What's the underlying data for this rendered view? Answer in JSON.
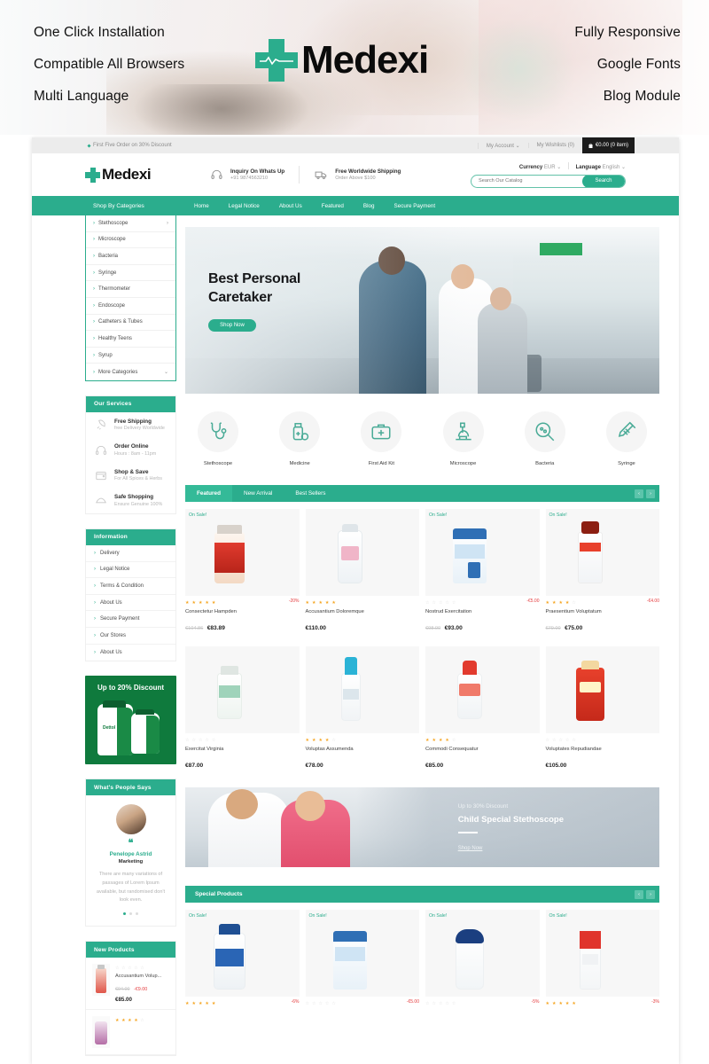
{
  "promo": {
    "left_features": [
      "One Click Installation",
      "Compatible All Browsers",
      "Multi Language"
    ],
    "right_features": [
      "Fully Responsive",
      "Google Fonts",
      "Blog Module"
    ],
    "logo_text": "Medexi"
  },
  "topbar": {
    "deal_text": "First Five Order on 30% Discount",
    "my_account": "My Account",
    "wishlists": "My Wishlists (0)",
    "cart": "€0.00 (0 item)"
  },
  "header": {
    "brand": "Medexi",
    "info": [
      {
        "title": "Inquiry On Whats Up",
        "sub": "+91 9874563210",
        "icon": "headset-icon"
      },
      {
        "title": "Free Worldwide Shipping",
        "sub": "Order Above $100",
        "icon": "truck-icon"
      }
    ],
    "currency_label": "Currency",
    "currency_value": "EUR",
    "language_label": "Language",
    "language_value": "English",
    "search_placeholder": "Search Our Catalog",
    "search_button": "Search"
  },
  "nav": {
    "categories_title": "Shop By Categories",
    "items": [
      "Home",
      "Legal Notice",
      "About Us",
      "Featured",
      "Blog",
      "Secure Payment"
    ]
  },
  "categories": [
    {
      "label": "Stethoscope",
      "arrow": "›"
    },
    {
      "label": "Microscope",
      "arrow": ""
    },
    {
      "label": "Bacteria",
      "arrow": ""
    },
    {
      "label": "Syringe",
      "arrow": ""
    },
    {
      "label": "Thermometer",
      "arrow": ""
    },
    {
      "label": "Endoscope",
      "arrow": ""
    },
    {
      "label": "Catheters & Tubes",
      "arrow": ""
    },
    {
      "label": "Healthy Teens",
      "arrow": ""
    },
    {
      "label": "Syrup",
      "arrow": ""
    },
    {
      "label": "More Categories",
      "arrow": "⌄"
    }
  ],
  "services": {
    "title": "Our Services",
    "items": [
      {
        "title": "Free Shipping",
        "sub": "free Delivery Worldwide",
        "icon": "rocket-icon"
      },
      {
        "title": "Order Online",
        "sub": "Hours : 8am - 11pm",
        "icon": "headset-icon"
      },
      {
        "title": "Shop & Save",
        "sub": "For All Spices & Herbs",
        "icon": "wallet-icon"
      },
      {
        "title": "Safe Shopping",
        "sub": "Ensure Genuine 100%",
        "icon": "shield-icon"
      }
    ]
  },
  "information": {
    "title": "Information",
    "items": [
      "Delivery",
      "Legal Notice",
      "Terms & Condition",
      "About Us",
      "Secure Payment",
      "Our Stores",
      "About Us"
    ]
  },
  "side_banner": {
    "title": "Up to 20% Discount",
    "product_label": "Dettol"
  },
  "testimonial": {
    "title": "What's People Says",
    "quote_mark": "❝",
    "name": "Penelope Astrid",
    "role": "Marketing",
    "text": "There are many variations of passages of Lorem Ipsum available, but randomised don't look even."
  },
  "new_products": {
    "title": "New Products",
    "items": [
      {
        "name": "Accusantium Volup...",
        "old": "€94.00",
        "cut": "-€9.00",
        "new": "€85.00",
        "rating": 0
      },
      {
        "name": "",
        "old": "",
        "cut": "",
        "new": "",
        "rating": 4
      }
    ]
  },
  "hero": {
    "title_line1": "Best Personal",
    "title_line2": "Caretaker",
    "button": "Shop Now"
  },
  "icon_categories": [
    {
      "name": "Stethoscope",
      "icon": "stethoscope-icon"
    },
    {
      "name": "Medicine",
      "icon": "medicine-bottle-icon"
    },
    {
      "name": "First Aid Kit",
      "icon": "first-aid-kit-icon"
    },
    {
      "name": "Microscope",
      "icon": "microscope-icon"
    },
    {
      "name": "Bacteria",
      "icon": "bacteria-magnifier-icon"
    },
    {
      "name": "Syringe",
      "icon": "syringe-icon"
    }
  ],
  "featured": {
    "tabs": [
      "Featured",
      "New Arrival",
      "Best Sellers"
    ],
    "active_tab": "Featured",
    "prev": "‹",
    "next": "›",
    "row1": [
      {
        "name": "Consectetur Hampden",
        "old": "€104.86",
        "new": "€83.89",
        "discount": "-20%",
        "on_sale": "On Sale!",
        "rating": 5,
        "product": "arthro-box"
      },
      {
        "name": "Accusantium Doloremque",
        "old": "",
        "new": "€110.00",
        "discount": "",
        "on_sale": "",
        "rating": 5,
        "product": "johnsons-powder"
      },
      {
        "name": "Nostrud Exercitation",
        "old": "€98.00",
        "new": "€93.00",
        "discount": "-€5.00",
        "on_sale": "On Sale!",
        "rating": 0,
        "product": "aptamil-tin"
      },
      {
        "name": "Praesentium Voluptatum",
        "old": "€79.00",
        "new": "€75.00",
        "discount": "-€4.00",
        "on_sale": "On Sale!",
        "rating": 4,
        "product": "diprobase-tube"
      }
    ],
    "row2": [
      {
        "name": "Exercitat Virginia",
        "old": "",
        "new": "€87.00",
        "discount": "",
        "on_sale": "",
        "rating": 0,
        "product": "nervocare-bottle"
      },
      {
        "name": "Voluptas Assumenda",
        "old": "",
        "new": "€78.00",
        "discount": "",
        "on_sale": "",
        "rating": 4,
        "product": "anne-french-bottle"
      },
      {
        "name": "Commodi Consequatur",
        "old": "",
        "new": "€85.00",
        "discount": "",
        "on_sale": "",
        "rating": 4,
        "product": "comfort-bottle"
      },
      {
        "name": "Voluptates Repudiandae",
        "old": "",
        "new": "€105.00",
        "discount": "",
        "on_sale": "",
        "rating": 0,
        "product": "eno-bottle"
      }
    ]
  },
  "mid_banner": {
    "kicker": "Up to 30% Discount",
    "title": "Child Special Stethoscope",
    "link": "Shop Now"
  },
  "special": {
    "title": "Special Products",
    "prev": "‹",
    "next": "›",
    "items": [
      {
        "on_sale": "On Sale!",
        "discount": "-6%",
        "rating": 5,
        "product": "lifeextension-bottle"
      },
      {
        "on_sale": "On Sale!",
        "discount": "-€5.00",
        "rating": 0,
        "product": "aptamil-tin"
      },
      {
        "on_sale": "On Sale!",
        "discount": "-5%",
        "rating": 0,
        "product": "dove-deodorant"
      },
      {
        "on_sale": "On Sale!",
        "discount": "-3%",
        "rating": 5,
        "product": "alpecin-bottle"
      }
    ]
  },
  "colors": {
    "brand_green": "#2bad8d",
    "dark": "#1c1c1c",
    "sale_red": "#e4393c",
    "star_gold": "#f5a623"
  }
}
